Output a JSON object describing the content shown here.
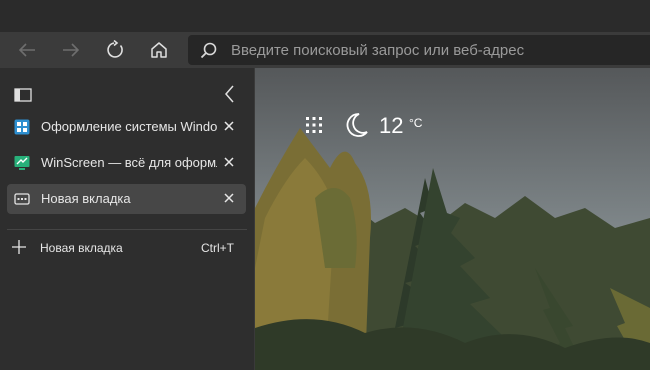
{
  "browser": {
    "address_placeholder": "Введите поисковый запрос или веб-адрес",
    "icons": [
      "back-arrow-icon",
      "forward-arrow-icon",
      "refresh-icon",
      "home-icon",
      "search-icon"
    ]
  },
  "sidebar": {
    "tabs": [
      {
        "title": "Оформление системы Windows",
        "favicon": "grid-favicon-icon",
        "active": false
      },
      {
        "title": "WinScreen — всё для оформления",
        "favicon": "monitor-favicon-icon",
        "active": false
      },
      {
        "title": "Новая вкладка",
        "favicon": "newtab-favicon-icon",
        "active": true
      }
    ],
    "new_tab": {
      "label": "Новая вкладка",
      "shortcut": "Ctrl+T"
    }
  },
  "weather": {
    "temperature": "12",
    "unit": "°C",
    "icon": "moon-icon"
  },
  "colors": {
    "chrome": "#3b3b3b",
    "sidebar": "#2e2e2e",
    "active_tab": "#474747",
    "accent": "#3aa6e0"
  }
}
